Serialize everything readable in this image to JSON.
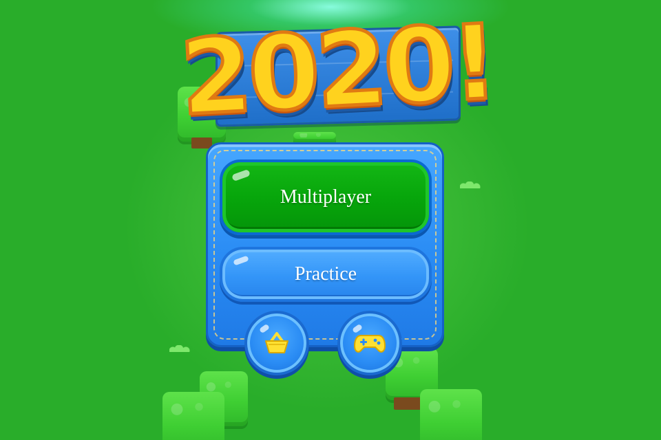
{
  "game": {
    "title": "2020!"
  },
  "menu": {
    "multiplayer_label": "Multiplayer",
    "practice_label": "Practice",
    "shop_icon": "basket-icon",
    "games_icon": "gamepad-icon"
  },
  "colors": {
    "background": "#29ad2a",
    "panel": "#2a8cf4",
    "multiplayer_button": "#07a60b",
    "practice_button": "#3395f8",
    "title_text": "#ffd21e",
    "title_outline": "#e07a12",
    "icon": "#ffe033"
  }
}
